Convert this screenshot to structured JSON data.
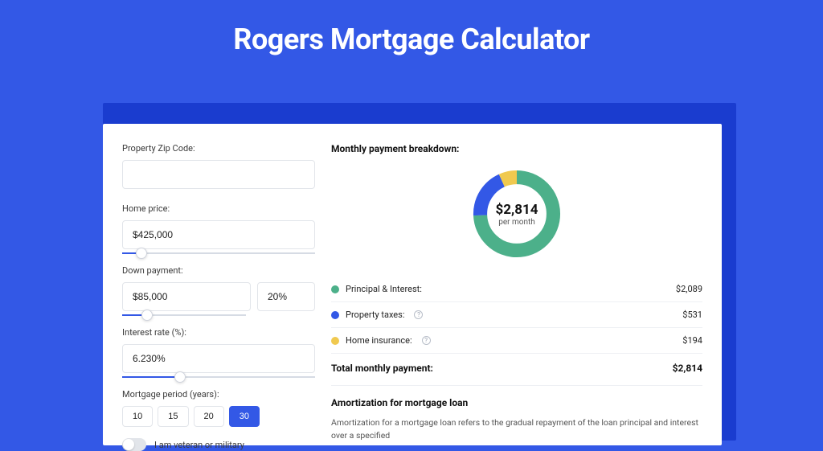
{
  "title": "Rogers Mortgage Calculator",
  "form": {
    "zip_label": "Property Zip Code:",
    "zip_value": "",
    "home_price_label": "Home price:",
    "home_price_value": "$425,000",
    "home_price_slider_pct": 10,
    "down_payment_label": "Down payment:",
    "down_payment_value": "$85,000",
    "down_payment_pct_value": "20%",
    "down_payment_slider_pct": 20,
    "interest_label": "Interest rate (%):",
    "interest_value": "6.230%",
    "interest_slider_pct": 30,
    "period_label": "Mortgage period (years):",
    "period_options": [
      "10",
      "15",
      "20",
      "30"
    ],
    "period_selected": "30",
    "veteran_label": "I am veteran or military",
    "veteran_on": false
  },
  "breakdown": {
    "title": "Monthly payment breakdown:",
    "center_amount": "$2,814",
    "center_sub": "per month",
    "items": [
      {
        "label": "Principal & Interest:",
        "value": "$2,089",
        "color": "#4cb08a",
        "help": false
      },
      {
        "label": "Property taxes:",
        "value": "$531",
        "color": "#3358e6",
        "help": true
      },
      {
        "label": "Home insurance:",
        "value": "$194",
        "color": "#f0c94f",
        "help": true
      }
    ],
    "total_label": "Total monthly payment:",
    "total_value": "$2,814"
  },
  "amortization": {
    "title": "Amortization for mortgage loan",
    "text": "Amortization for a mortgage loan refers to the gradual repayment of the loan principal and interest over a specified"
  },
  "chart_data": {
    "type": "pie",
    "title": "Monthly payment breakdown",
    "series": [
      {
        "name": "Principal & Interest",
        "value": 2089,
        "color": "#4cb08a"
      },
      {
        "name": "Property taxes",
        "value": 531,
        "color": "#3358e6"
      },
      {
        "name": "Home insurance",
        "value": 194,
        "color": "#f0c94f"
      }
    ],
    "total": 2814,
    "center_label": "$2,814 per month"
  }
}
